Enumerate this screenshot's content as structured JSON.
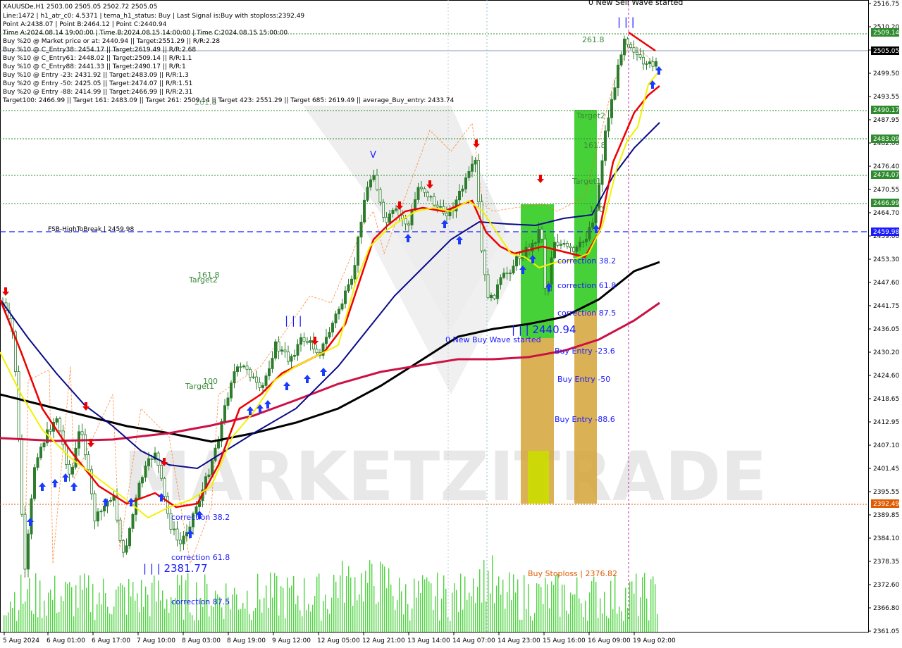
{
  "symbol_line": "XAUUSDe,H1  2503.00 2505.05 2502.72 2505.05",
  "info_lines": [
    "Line:1472 | h1_atr_c0: 4.5371 | tema_h1_status: Buy | Last Signal is:Buy with stoploss:2392.49",
    "Point A:2438.07 | Point B:2464.12 | Point C:2440.94",
    "Time A:2024.08.14 19:00:00 | Time B:2024.08.15 14:00:00 | Time C:2024.08.15 15:00:00",
    "Buy %20 @ Market price or at: 2440.94 || Target:2551.29 || R/R:2.28",
    "Buy %10 @ C_Entry38: 2454.17 || Target:2619.49 || R/R:2.68",
    "Buy %10 @ C_Entry61: 2448.02 || Target:2509.14 || R/R:1.1",
    "Buy %10 @ C_Entry88: 2441.33 || Target:2490.17 || R/R:1",
    "Buy %10 @ Entry -23: 2431.92 || Target:2483.09 || R/R:1.3",
    "Buy %20 @ Entry -50: 2425.05 || Target:2474.07 || R/R:1.51",
    "Buy %20 @ Entry -88: 2414.99 || Target:2466.99 || R/R:2.31",
    "Target100: 2466.99 || Target 161: 2483.09 || Target 261: 2509.14 || Target 423: 2551.29 || Target 685: 2619.49 || average_Buy_entry: 2433.74"
  ],
  "price_axis": [
    "2516.75",
    "2510.20",
    "2505.05",
    "2499.50",
    "2493.55",
    "2487.95",
    "2482.00",
    "2476.40",
    "2470.55",
    "2464.70",
    "2459.00",
    "2453.30",
    "2447.60",
    "2441.75",
    "2436.05",
    "2430.20",
    "2424.60",
    "2418.65",
    "2412.95",
    "2407.10",
    "2401.45",
    "2395.55",
    "2389.85",
    "2384.10",
    "2378.35",
    "2372.60",
    "2366.80",
    "2361.05"
  ],
  "time_axis": [
    "5 Aug 2024",
    "6 Aug 01:00",
    "6 Aug 17:00",
    "7 Aug 10:00",
    "8 Aug 03:00",
    "8 Aug 19:00",
    "9 Aug 12:00",
    "12 Aug 05:00",
    "12 Aug 21:00",
    "13 Aug 14:00",
    "14 Aug 07:00",
    "14 Aug 23:00",
    "15 Aug 16:00",
    "16 Aug 09:00",
    "19 Aug 02:00"
  ],
  "level_labels": [
    {
      "text": "2509.14",
      "color": "#2e8b2e"
    },
    {
      "text": "2505.05",
      "color": "#000000"
    },
    {
      "text": "2490.17",
      "color": "#2e8b2e"
    },
    {
      "text": "2483.09",
      "color": "#2e8b2e"
    },
    {
      "text": "2474.07",
      "color": "#2e8b2e"
    },
    {
      "text": "2466.99",
      "color": "#2e8b2e"
    },
    {
      "text": "2459.98",
      "color": "#1a1aff"
    },
    {
      "text": "2392.49",
      "color": "#e05a00"
    }
  ],
  "annotations": {
    "sell_wave": "0 New Sell Wave started",
    "fsb": "FSB-HighToBreak  |  2459.98",
    "t261": "261.8",
    "t161_right": "161.8",
    "target2_right": "Target2",
    "target1_right": "Target1",
    "t100_right": "100",
    "t161_left": "161.8",
    "target2_left": "Target2",
    "t100_left": "100",
    "target1_left": "Target1",
    "t261_faded": "261.8",
    "corr382_right": "correction 38.2",
    "corr618_right": "correction 61.8",
    "corr875_right": "correction 87.5",
    "point_c": "| | | 2440.94",
    "buy_wave": "0 New Buy Wave started",
    "entry236": "Buy Entry -23.6",
    "entry50": "Buy Entry -50",
    "entry886": "Buy Entry -88.6",
    "stoploss": "Buy Stoploss | 2376.82",
    "corr382_left": "correction 38.2",
    "corr618_left": "correction 61.8",
    "corr875_left": "correction 87.5",
    "point_left": "| | | 2381.77",
    "wave_marks_left": "| | |",
    "wave_marks_top": "| | |",
    "v_mark": "V"
  },
  "watermark": "MARKETZITRADE",
  "colors": {
    "bull": "#2e7d2e",
    "sma_long": "#000000",
    "sma_mid": "#cc1144",
    "ma_blue": "#0a0a88",
    "ma_red": "#ee0000",
    "ma_yellow": "#f2f200",
    "target_line": "#2e8b2e",
    "fsb_line": "#1a1aff",
    "stop_line": "#e05a00"
  }
}
